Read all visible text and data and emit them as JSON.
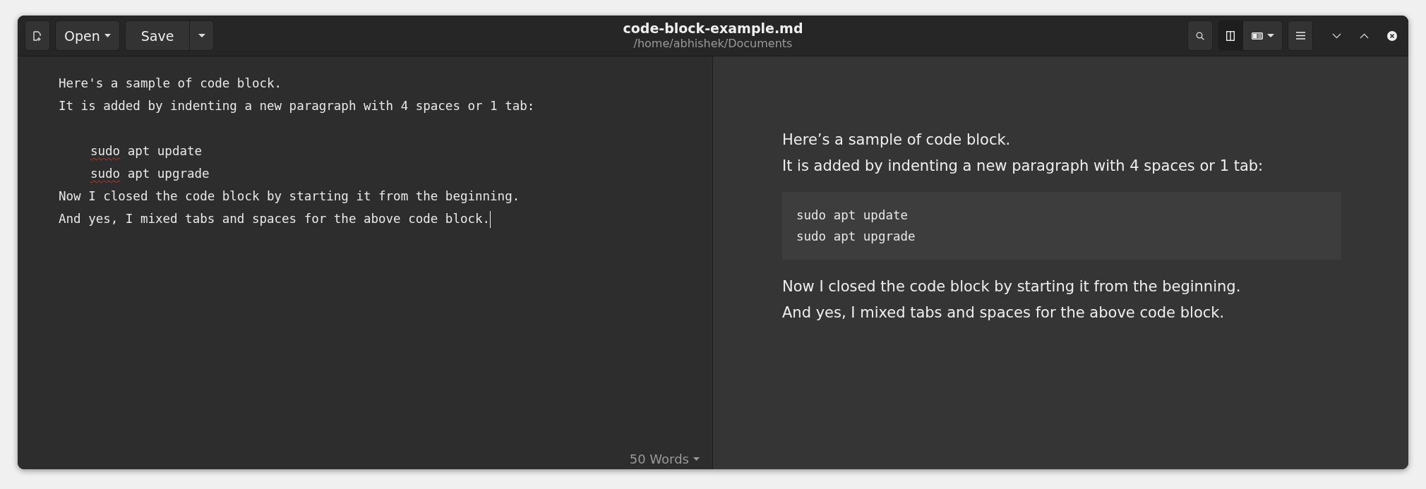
{
  "header": {
    "open_label": "Open",
    "save_label": "Save",
    "title": "code-block-example.md",
    "subtitle": "/home/abhishek/Documents",
    "layout_buttons": [
      {
        "kind": "split",
        "selected": true
      },
      {
        "kind": "preview",
        "selected": false
      }
    ]
  },
  "editor": {
    "lines": [
      {
        "kind": "text",
        "indented": false,
        "cursor": false,
        "segments": [
          {
            "text": "Here's a sample of code block.",
            "misspelled": false
          }
        ]
      },
      {
        "kind": "text",
        "indented": false,
        "cursor": false,
        "segments": [
          {
            "text": "It is added by indenting a new paragraph with 4 spaces or 1 tab:",
            "misspelled": false
          }
        ]
      },
      {
        "kind": "blank"
      },
      {
        "kind": "text",
        "indented": true,
        "cursor": false,
        "segments": [
          {
            "text": "sudo",
            "misspelled": true
          },
          {
            "text": " apt update",
            "misspelled": false
          }
        ]
      },
      {
        "kind": "text",
        "indented": true,
        "cursor": false,
        "segments": [
          {
            "text": "sudo",
            "misspelled": true
          },
          {
            "text": " apt upgrade",
            "misspelled": false
          }
        ]
      },
      {
        "kind": "text",
        "indented": false,
        "cursor": false,
        "segments": [
          {
            "text": "Now I closed the code block by starting it from the beginning.",
            "misspelled": false
          }
        ]
      },
      {
        "kind": "text",
        "indented": false,
        "cursor": true,
        "segments": [
          {
            "text": "And yes, I mixed tabs and spaces for the above code block.",
            "misspelled": false
          }
        ]
      }
    ],
    "word_count": "50 Words"
  },
  "preview": {
    "blocks": [
      {
        "kind": "paragraph",
        "lines": [
          "Here’s a sample of code block.",
          "It is added by indenting a new paragraph with 4 spaces or 1 tab:"
        ]
      },
      {
        "kind": "code",
        "lines": [
          "sudo apt update",
          "sudo apt upgrade"
        ]
      },
      {
        "kind": "paragraph",
        "lines": [
          "Now I closed the code block by starting it from the beginning.",
          "And yes, I mixed tabs and spaces for the above code block."
        ]
      }
    ]
  }
}
